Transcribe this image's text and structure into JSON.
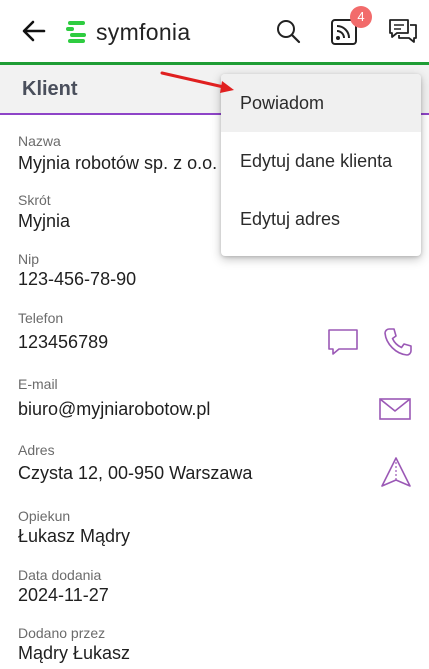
{
  "app": {
    "logo_text": "symfonia",
    "notification_count": "4",
    "brand_green": "#1f9d35",
    "accent_purple": "#8e44c8"
  },
  "icons": {
    "back": "arrow-left-icon",
    "search": "search-icon",
    "feed": "rss-feed-icon",
    "chat": "chat-bubbles-icon",
    "message": "message-icon",
    "phone": "phone-icon",
    "mail": "mail-icon",
    "navigate": "navigation-icon"
  },
  "section": {
    "title": "Klient"
  },
  "fields": {
    "nazwa": {
      "label": "Nazwa",
      "value": "Myjnia robotów sp. z o.o."
    },
    "skrot": {
      "label": "Skrót",
      "value": "Myjnia"
    },
    "nip": {
      "label": "Nip",
      "value": "123-456-78-90"
    },
    "telefon": {
      "label": "Telefon",
      "value": "123456789"
    },
    "email": {
      "label": "E-mail",
      "value": "biuro@myjniarobotow.pl"
    },
    "adres": {
      "label": "Adres",
      "value": "Czysta 12, 00-950 Warszawa"
    },
    "opiekun": {
      "label": "Opiekun",
      "value": "Łukasz Mądry"
    },
    "data_dodania": {
      "label": "Data dodania",
      "value": "2024-11-27"
    },
    "dodano_przez": {
      "label": "Dodano przez",
      "value": "Mądry Łukasz"
    }
  },
  "menu": {
    "items": [
      {
        "label": "Powiadom"
      },
      {
        "label": "Edytuj dane klienta"
      },
      {
        "label": "Edytuj adres"
      }
    ]
  }
}
